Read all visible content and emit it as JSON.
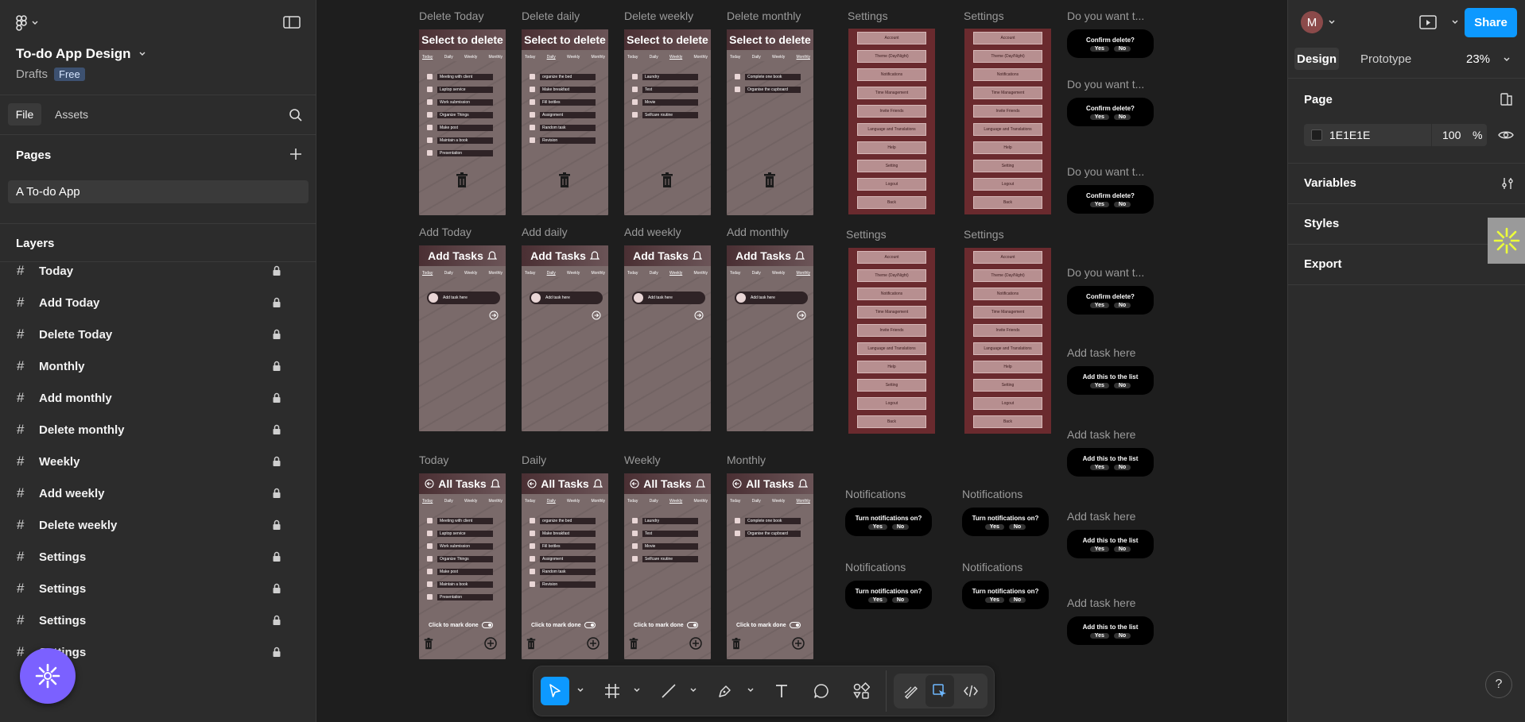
{
  "file": {
    "title": "To-do App Design",
    "location": "Drafts",
    "plan_badge": "Free"
  },
  "left_tabs": {
    "file": "File",
    "assets": "Assets"
  },
  "pages": {
    "heading": "Pages",
    "items": [
      "A To-do App"
    ]
  },
  "layers": {
    "heading": "Layers",
    "items": [
      "Today",
      "Add Today",
      "Delete Today",
      "Monthly",
      "Add monthly",
      "Delete monthly",
      "Weekly",
      "Add weekly",
      "Delete weekly",
      "Settings",
      "Settings",
      "Settings",
      "Settings"
    ]
  },
  "header_right": {
    "avatar": "M",
    "share_label": "Share",
    "tabs": [
      "Design",
      "Prototype"
    ],
    "zoom": "23%"
  },
  "page_panel": {
    "heading": "Page",
    "bg_color": "1E1E1E",
    "opacity": "100",
    "percent": "%",
    "sections": [
      "Variables",
      "Styles",
      "Export"
    ]
  },
  "help": "?",
  "canvas": {
    "delete_frames": [
      {
        "label": "Delete Today",
        "title": "Select to delete",
        "items": [
          "Meeting with client",
          "Laptop service",
          "Work submission",
          "Organize Things",
          "Make post",
          "Maintain a book",
          "Presentation"
        ]
      },
      {
        "label": "Delete daily",
        "title": "Select to delete",
        "items": [
          "organize the bed",
          "Make breakfast",
          "Fill bottles",
          "Assignment",
          "Random task",
          "Revision"
        ]
      },
      {
        "label": "Delete weekly",
        "title": "Select to delete",
        "items": [
          "Laundry",
          "Test",
          "Movie",
          "Selfcare routine"
        ]
      },
      {
        "label": "Delete monthly",
        "title": "Select to delete",
        "items": [
          "Complete one book",
          "Organise the cupboard"
        ]
      }
    ],
    "add_frames": [
      {
        "label": "Add Today",
        "title": "Add Tasks",
        "input": "Add task here"
      },
      {
        "label": "Add daily",
        "title": "Add Tasks",
        "input": "Add task here"
      },
      {
        "label": "Add weekly",
        "title": "Add Tasks",
        "input": "Add task here"
      },
      {
        "label": "Add monthly",
        "title": "Add Tasks",
        "input": "Add task here"
      }
    ],
    "all_frames": [
      {
        "label": "Today",
        "title": "All Tasks",
        "items": [
          "Meeting with client",
          "Laptop service",
          "Work submission",
          "Organize Things",
          "Make post",
          "Maintain a book",
          "Presentation"
        ],
        "footer": "Click to mark done"
      },
      {
        "label": "Daily",
        "title": "All Tasks",
        "items": [
          "organize the bed",
          "Make breakfast",
          "Fill bottles",
          "Assignment",
          "Random task",
          "Revision"
        ],
        "footer": "Click to mark done"
      },
      {
        "label": "Weekly",
        "title": "All Tasks",
        "items": [
          "Laundry",
          "Test",
          "Movie",
          "Selfcare routine"
        ],
        "footer": "Click to mark done"
      },
      {
        "label": "Monthly",
        "title": "All Tasks",
        "items": [
          "Complete one book",
          "Organise the cupboard"
        ],
        "footer": "Click to mark done"
      }
    ],
    "tabs": [
      "Today",
      "Daily",
      "Weekly",
      "Monthly"
    ],
    "settings_label": "Settings",
    "settings_items": [
      "Account",
      "Theme (Day/Night)",
      "Notifications",
      "Time Management",
      "Invite Friends",
      "Language and Translations",
      "Help",
      "Setting",
      "Logout",
      "Back"
    ],
    "notifications": {
      "label": "Notifications",
      "text": "Turn notifications on?",
      "yes": "Yes",
      "no": "No"
    },
    "confirm": {
      "label": "Do you want t...",
      "text": "Confirm delete?",
      "yes": "Yes",
      "no": "No"
    },
    "addtask": {
      "label": "Add task here",
      "text": "Add this to the list",
      "yes": "Yes",
      "no": "No"
    }
  },
  "colors": {
    "accent": "#0d99ff",
    "plugin": "#7b61ff"
  }
}
